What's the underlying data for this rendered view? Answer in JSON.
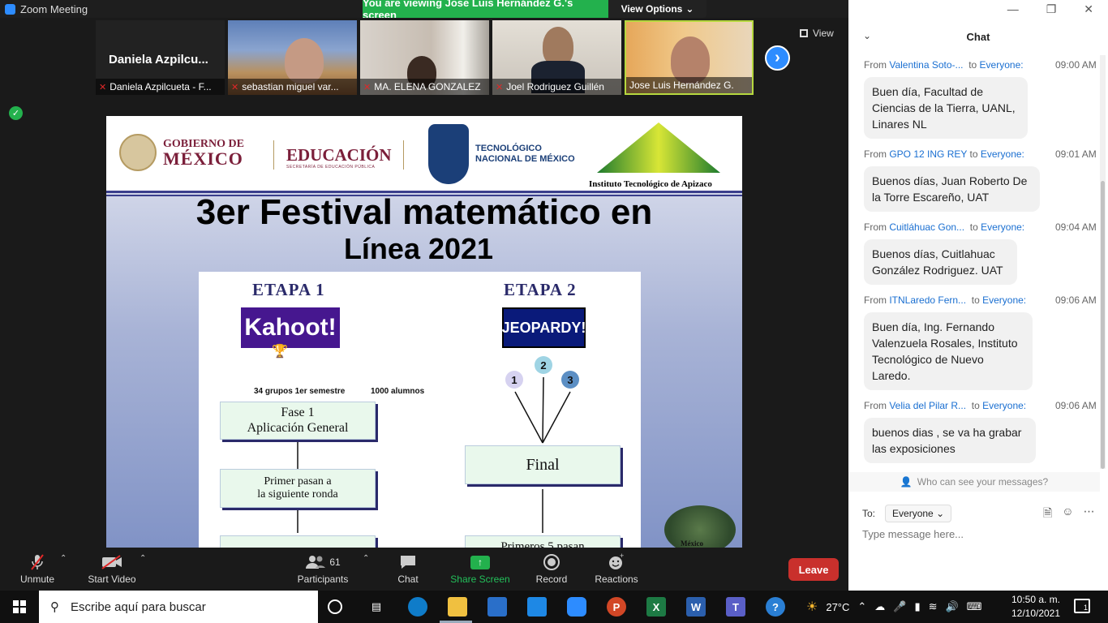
{
  "window": {
    "title": "Zoom Meeting",
    "banner_text": "You are viewing Jose Luis Hernández G.'s screen",
    "view_options_label": "View Options",
    "view_label": "View"
  },
  "participants": [
    {
      "name": "Daniela Azpilcueta - F...",
      "big_name": "Daniela  Azpilcu..."
    },
    {
      "name": "sebastian miguel var..."
    },
    {
      "name": "MA. ELENA GONZALEZ"
    },
    {
      "name": "Joel Rodriguez Guillén"
    },
    {
      "name": "Jose Luis Hernández G."
    }
  ],
  "slide": {
    "gob_line1": "GOBIERNO DE",
    "gob_line2": "MÉXICO",
    "edu_title": "EDUCACIÓN",
    "edu_sub": "SECRETARÍA DE EDUCACIÓN PÚBLICA",
    "tecnm_line1": "TECNOLÓGICO",
    "tecnm_line2": "NACIONAL DE MÉXICO",
    "ita_name": "Instituto Tecnológico de Apizaco",
    "title": "3er Festival matemático en",
    "subtitle": "Línea 2021",
    "etapa1": "ETAPA 1",
    "etapa2": "ETAPA 2",
    "kahoot": "Kahoot!",
    "jeopardy": "JEOPARDY!",
    "groups": "34 grupos 1er semestre",
    "students": "1000 alumnos",
    "fase1_line1": "Fase 1",
    "fase1_line2": "Aplicación General",
    "primer_line1": "Primer    pasan a",
    "primer_line2": "la siguiente ronda",
    "final": "Final",
    "primeros5": "Primeros 5 pasan",
    "circles": [
      "1",
      "2",
      "3"
    ],
    "aztec_label": "México"
  },
  "toolbar": {
    "unmute": "Unmute",
    "start_video": "Start Video",
    "participants": "Participants",
    "participants_count": "61",
    "chat": "Chat",
    "share_screen": "Share Screen",
    "record": "Record",
    "reactions": "Reactions",
    "leave": "Leave"
  },
  "chat": {
    "title": "Chat",
    "messages": [
      {
        "from": "Valentina Soto-...",
        "to": "Everyone:",
        "time": "09:00 AM",
        "text": "Buen día, Facultad de Ciencias de la Tierra, UANL, Linares NL"
      },
      {
        "from": "GPO 12 ING REY",
        "to": "Everyone:",
        "time": "09:01 AM",
        "text": "Buenos días, Juan Roberto De la Torre Escareño, UAT"
      },
      {
        "from": "Cuitláhuac Gon...",
        "to": "Everyone:",
        "time": "09:04 AM",
        "text": "Buenos días, Cuitlahuac González Rodriguez. UAT"
      },
      {
        "from": "ITNLaredo Fern...",
        "to": "Everyone:",
        "time": "09:06 AM",
        "text": "Buen día, Ing. Fernando Valenzuela Rosales, Instituto Tecnológico de Nuevo Laredo."
      },
      {
        "from": "Velia del Pilar R...",
        "to": "Everyone:",
        "time": "09:06 AM",
        "text": "buenos dias , se va ha grabar las exposiciones"
      }
    ],
    "from_label": "From",
    "to_label": "to",
    "who_sees": "Who can see your messages?",
    "to_prefix": "To:",
    "to_value": "Everyone",
    "input_placeholder": "Type message here..."
  },
  "taskbar": {
    "search_placeholder": "Escribe aquí para buscar",
    "temperature": "27°C",
    "time": "10:50 a. m.",
    "date": "12/10/2021",
    "notifications": "1"
  }
}
